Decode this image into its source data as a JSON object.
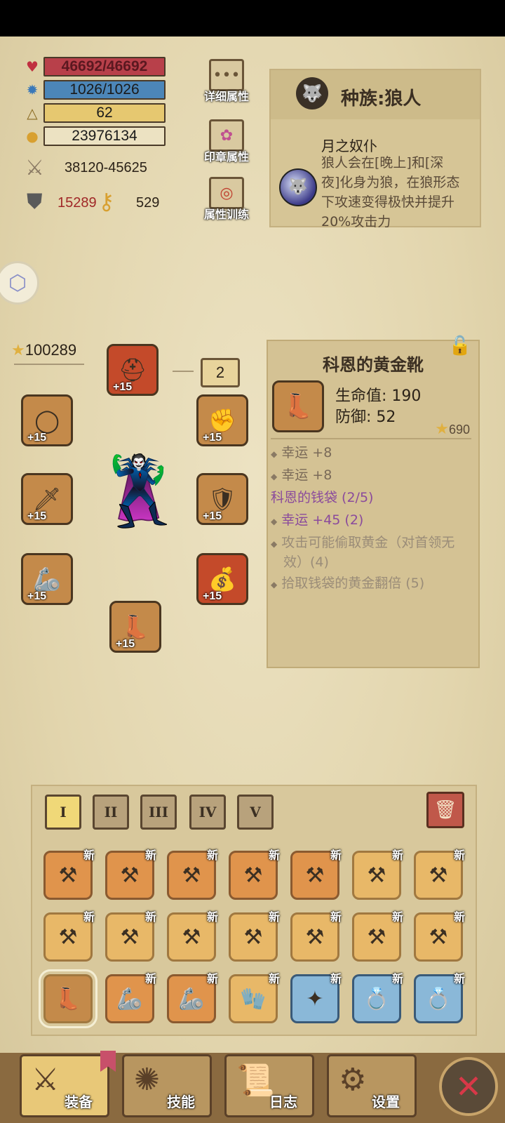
{
  "stats": {
    "hp": "46692/46692",
    "mp": "1026/1026",
    "level": "62",
    "gold": "23976134",
    "attack": "38120-45625",
    "defense": "15289",
    "luck": "529"
  },
  "side_buttons": {
    "detail": "详细属性",
    "seal": "印章属性",
    "training": "属性训练"
  },
  "race": {
    "title": "种族:狼人",
    "trait_name": "月之奴仆",
    "trait_desc": "狼人会在[晚上]和[深夜]化身为狼，在狼形态下攻速变得极快并提升20%攻击力"
  },
  "equipment": {
    "power": "100289",
    "page": "2",
    "slot_level": "+15"
  },
  "item": {
    "name": "科恩的黄金靴",
    "hp_stat": "生命值: 190",
    "def_stat": "防御: 52",
    "score": "690",
    "attrs": [
      "幸运 +8",
      "幸运 +8"
    ],
    "set_title": "科恩的钱袋 (2/5)",
    "set_bonuses": [
      "幸运 +45 (2)",
      "攻击可能偷取黄金（对首领无效）(4)",
      "拾取钱袋的黄金翻倍 (5)"
    ]
  },
  "inventory": {
    "tabs": [
      "I",
      "II",
      "III",
      "IV",
      "V"
    ],
    "new_label": "新"
  },
  "nav": {
    "equip": "装备",
    "skills": "技能",
    "log": "日志",
    "settings": "设置"
  },
  "colors": {
    "hp_bar": "#b8404a",
    "mp_bar": "#4c86b8",
    "level_bar": "#e6c870",
    "set_purple": "#8a4a9c",
    "close_red": "#d83848"
  }
}
